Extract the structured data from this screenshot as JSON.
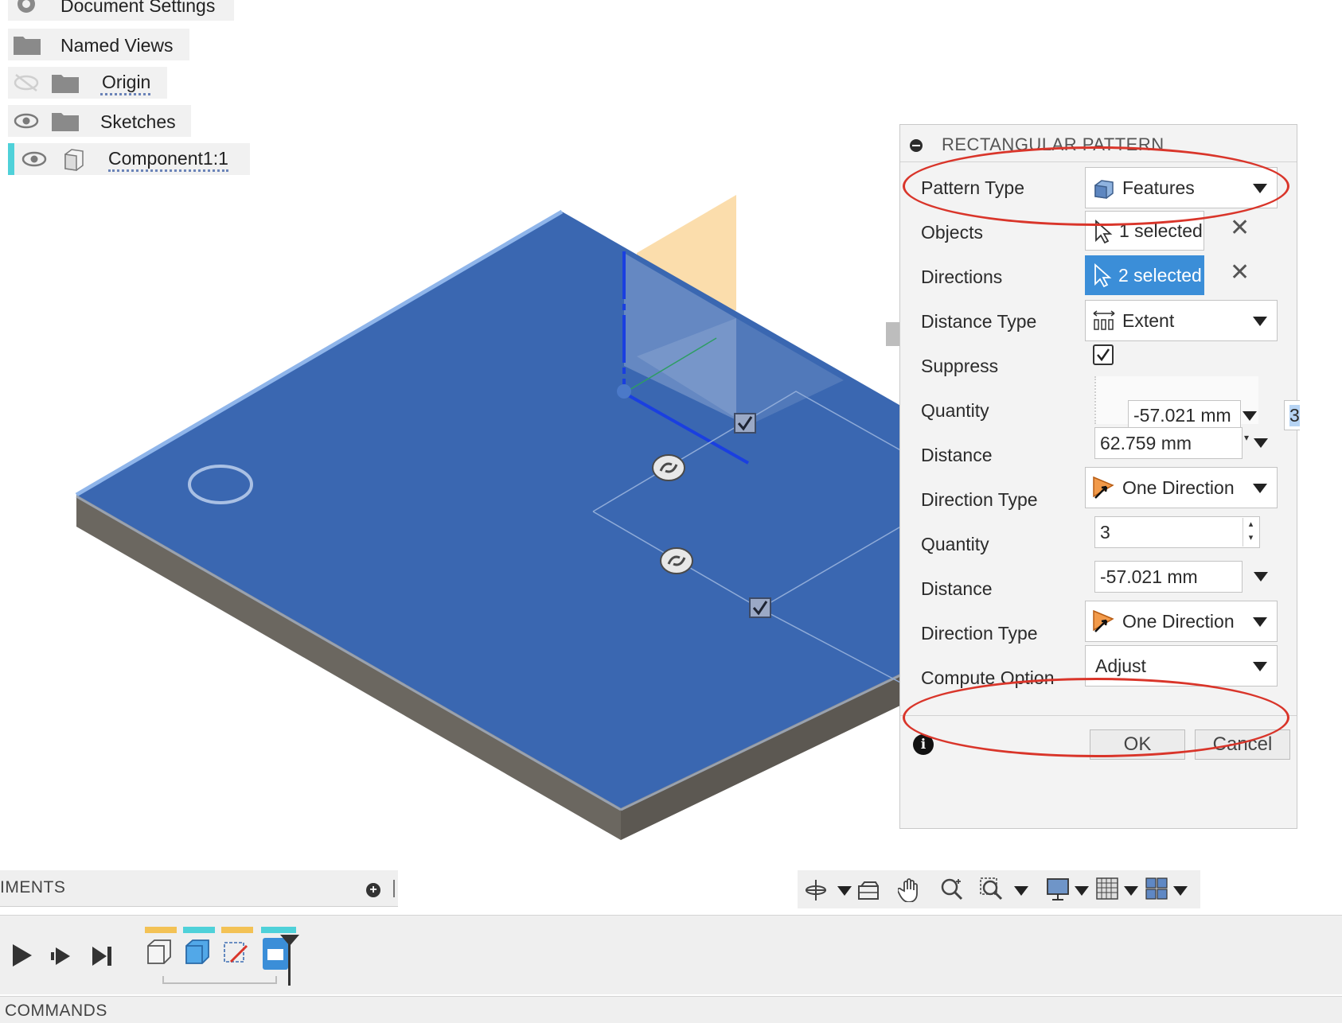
{
  "browser": {
    "items": [
      {
        "label": "Document Settings",
        "icon": "gear-icon"
      },
      {
        "label": "Named Views",
        "icon": "folder-icon"
      },
      {
        "label": "Origin",
        "icon": "folder-icon",
        "visibility": "hidden-eye-icon"
      },
      {
        "label": "Sketches",
        "icon": "folder-icon",
        "visibility": "eye-icon"
      },
      {
        "label": "Component1:1",
        "icon": "component-icon",
        "visibility": "eye-icon"
      }
    ]
  },
  "dialog": {
    "title": "RECTANGULAR PATTERN",
    "rows": {
      "pattern_type": {
        "label": "Pattern Type",
        "value": "Features"
      },
      "objects": {
        "label": "Objects",
        "value": "1 selected"
      },
      "directions": {
        "label": "Directions",
        "value": "2 selected"
      },
      "distance_type": {
        "label": "Distance Type",
        "value": "Extent"
      },
      "suppress": {
        "label": "Suppress",
        "checked": true
      },
      "quantity1": {
        "label": "Quantity",
        "overlay_value": "-57.021 mm",
        "overlay_input": "3"
      },
      "distance1": {
        "label": "Distance",
        "value": "62.759 mm"
      },
      "direction_type1": {
        "label": "Direction Type",
        "value": "One Direction"
      },
      "quantity2": {
        "label": "Quantity",
        "value": "3"
      },
      "distance2": {
        "label": "Distance",
        "value": "-57.021 mm"
      },
      "direction_type2": {
        "label": "Direction Type",
        "value": "One Direction"
      },
      "compute_option": {
        "label": "Compute Option",
        "value": "Adjust"
      }
    },
    "ok_label": "OK",
    "cancel_label": "Cancel"
  },
  "panels": {
    "comments_label": "IMENTS",
    "commands_label": "COMMANDS"
  },
  "colors": {
    "plate_top": "#3a67b1",
    "plate_side": "#6b6760",
    "selection_blue": "#3b8ed8",
    "highlight_circle": "#d9352a",
    "plane_orange": "#fbd9a3"
  }
}
